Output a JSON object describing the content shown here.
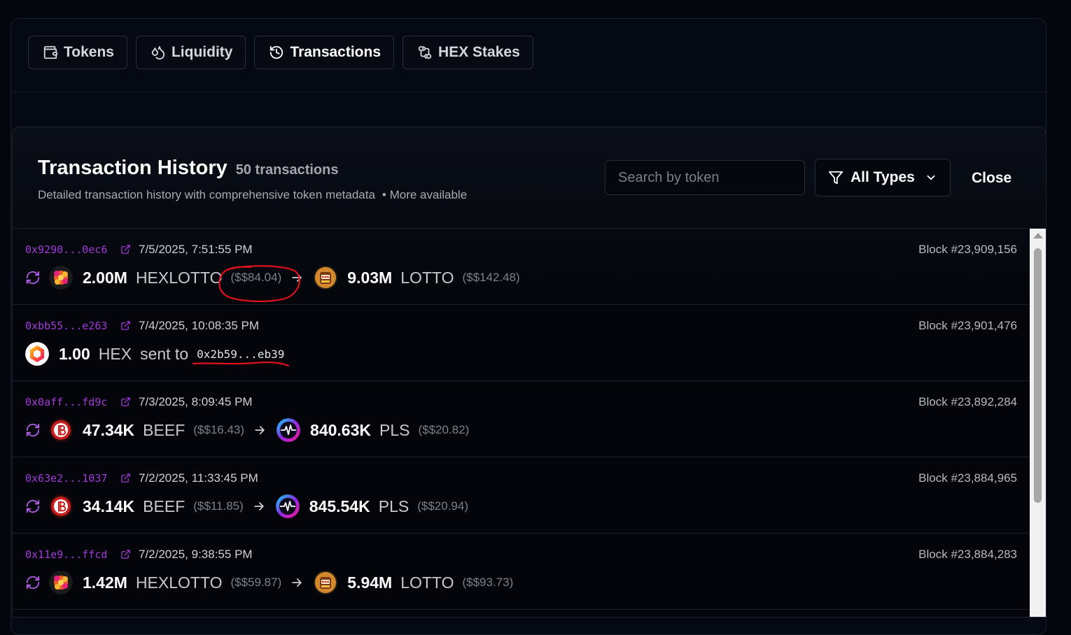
{
  "tabs": [
    {
      "label": "Tokens",
      "icon": "wallet-icon"
    },
    {
      "label": "Liquidity",
      "icon": "droplets-icon"
    },
    {
      "label": "Transactions",
      "icon": "history-icon",
      "active": true
    },
    {
      "label": "HEX Stakes",
      "icon": "git-compare-icon"
    }
  ],
  "panel": {
    "title": "Transaction History",
    "count": "50 transactions",
    "subtitle": "Detailed transaction history with comprehensive token metadata",
    "more": "• More available",
    "search_placeholder": "Search by token",
    "filter_label": "All Types",
    "close_label": "Close"
  },
  "transactions": [
    {
      "hash": "0x9290...0ec6",
      "date": "7/5/2025, 7:51:55 PM",
      "block": "Block #23,909,156",
      "type": "swap",
      "from": {
        "amount": "2.00M",
        "symbol": "HEXLOTTO",
        "usd": "($$84.04)"
      },
      "to": {
        "amount": "9.03M",
        "symbol": "LOTTO",
        "usd": "($$142.48)"
      }
    },
    {
      "hash": "0xbb55...e263",
      "date": "7/4/2025, 10:08:35 PM",
      "block": "Block #23,901,476",
      "type": "transfer",
      "from": {
        "amount": "1.00",
        "symbol": "HEX"
      },
      "sent_to_label": "sent to",
      "recipient": "0x2b59...eb39"
    },
    {
      "hash": "0x0aff...fd9c",
      "date": "7/3/2025, 8:09:45 PM",
      "block": "Block #23,892,284",
      "type": "swap",
      "from": {
        "amount": "47.34K",
        "symbol": "BEEF",
        "usd": "($$16.43)"
      },
      "to": {
        "amount": "840.63K",
        "symbol": "PLS",
        "usd": "($$20.82)"
      }
    },
    {
      "hash": "0x63e2...1037",
      "date": "7/2/2025, 11:33:45 PM",
      "block": "Block #23,884,965",
      "type": "swap",
      "from": {
        "amount": "34.14K",
        "symbol": "BEEF",
        "usd": "($$11.85)"
      },
      "to": {
        "amount": "845.54K",
        "symbol": "PLS",
        "usd": "($$20.94)"
      }
    },
    {
      "hash": "0x11e9...ffcd",
      "date": "7/2/2025, 9:38:55 PM",
      "block": "Block #23,884,283",
      "type": "swap",
      "from": {
        "amount": "1.42M",
        "symbol": "HEXLOTTO",
        "usd": "($$59.87)"
      },
      "to": {
        "amount": "5.94M",
        "symbol": "LOTTO",
        "usd": "($$93.73)"
      }
    }
  ],
  "colors": {
    "accent_hash": "#a43ad8",
    "annotation": "#e0101c"
  }
}
